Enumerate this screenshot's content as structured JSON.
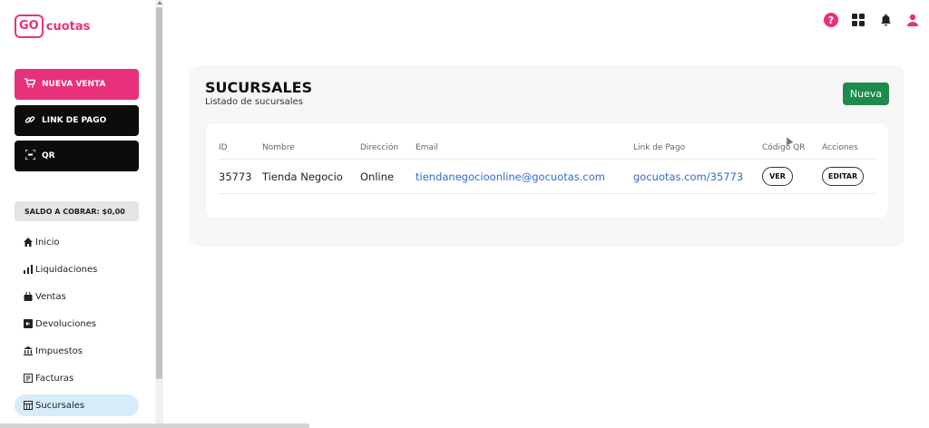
{
  "brand": {
    "logo_box": "GO",
    "logo_text": "cuotas",
    "color": "#e8317a"
  },
  "sidebar": {
    "buttons": [
      {
        "label": "NUEVA VENTA",
        "icon": "cart-icon"
      },
      {
        "label": "LINK DE PAGO",
        "icon": "link-icon"
      },
      {
        "label": "QR",
        "icon": "qr-icon"
      }
    ],
    "saldo": "SALDO A COBRAR: $0,00",
    "items": [
      {
        "label": "Inicio",
        "icon": "home-icon"
      },
      {
        "label": "Liquidaciones",
        "icon": "bar-chart-icon"
      },
      {
        "label": "Ventas",
        "icon": "bag-icon"
      },
      {
        "label": "Devoluciones",
        "icon": "return-icon"
      },
      {
        "label": "Impuestos",
        "icon": "bank-icon"
      },
      {
        "label": "Facturas",
        "icon": "invoice-icon"
      },
      {
        "label": "Sucursales",
        "icon": "store-icon",
        "active": true
      }
    ]
  },
  "topbar": {
    "icons": [
      "help-icon",
      "apps-grid-icon",
      "bell-icon",
      "user-icon"
    ],
    "help_glyph": "?"
  },
  "main": {
    "title": "SUCURSALES",
    "subtitle": "Listado de sucursales",
    "new_button": "Nueva",
    "accent_green": "#1e8a4c",
    "table": {
      "headers": [
        "ID",
        "Nombre",
        "Dirección",
        "Email",
        "Link de Pago",
        "Código QR",
        "Acciones"
      ],
      "rows": [
        {
          "id": "35773",
          "nombre": "Tienda Negocio",
          "direccion": "Online",
          "email": "tiendanegocioonline@gocuotas.com",
          "link": "gocuotas.com/35773",
          "qr_button": "VER",
          "action_button": "EDITAR"
        }
      ]
    }
  }
}
